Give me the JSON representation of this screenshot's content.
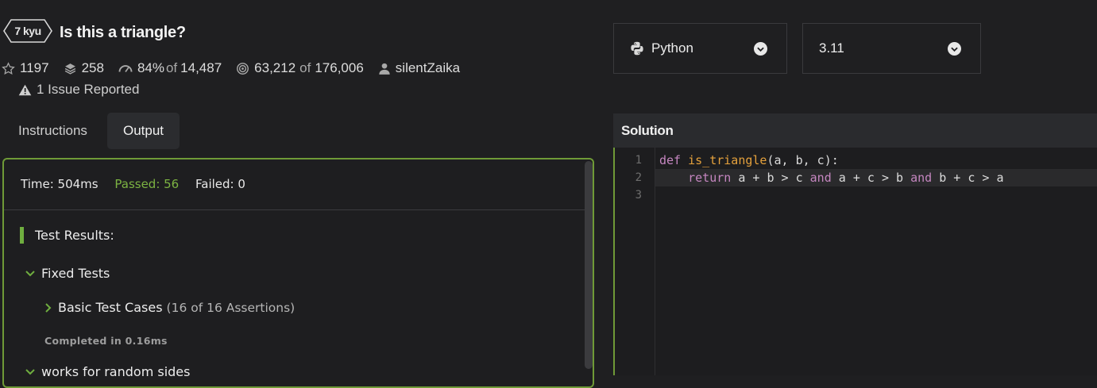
{
  "kata": {
    "rank": "7 kyu",
    "title": "Is this a triangle?"
  },
  "stats": {
    "stars": "1197",
    "collections": "258",
    "satisfaction": "84%",
    "satisfaction_of": "of",
    "votes": "14,487",
    "completed": "63,212",
    "completed_of": "of",
    "attempted": "176,006",
    "author": "silentZaika"
  },
  "issues": "1 Issue Reported",
  "tabs": [
    {
      "label": "Instructions",
      "active": false
    },
    {
      "label": "Output",
      "active": true
    }
  ],
  "output": {
    "time": "Time: 504ms",
    "passed": "Passed: 56",
    "failed": "Failed: 0",
    "results_header": "Test Results:",
    "groups": [
      {
        "label": "Fixed Tests"
      },
      {
        "label": "Basic Test Cases",
        "assertions": "(16 of 16 Assertions)",
        "completed": "Completed in 0.16ms"
      },
      {
        "label": "works for random sides"
      }
    ]
  },
  "selectors": {
    "language": "Python",
    "version": "3.11"
  },
  "editor": {
    "header": "Solution",
    "line_numbers": [
      "1",
      "2",
      "3"
    ],
    "code": {
      "def": "def",
      "fn_name": "is_triangle",
      "params": "(a, b, c):",
      "return_kw": "return",
      "expr1": " a + b > c ",
      "and1": "and",
      "expr2": " a + c > b ",
      "and2": "and",
      "expr3": " b + c > a"
    }
  },
  "colors": {
    "accent_green": "#6fae3f",
    "panel_border": "#6f9a37",
    "passed": "#7cb342",
    "keyword": "#c586c0",
    "function": "#e5a13c"
  }
}
